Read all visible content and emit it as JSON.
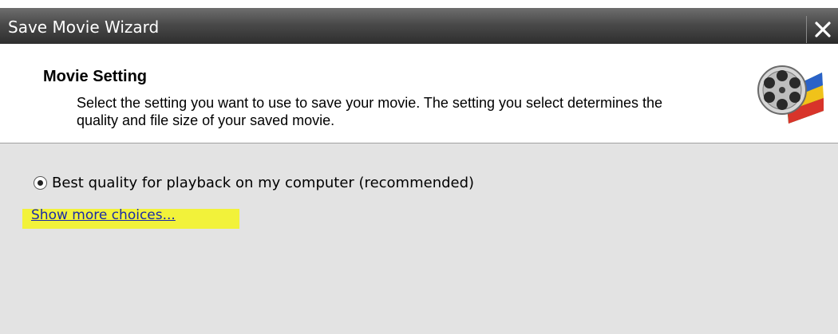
{
  "window": {
    "title": "Save Movie Wizard",
    "close_icon": "close-icon"
  },
  "header": {
    "title": "Movie Setting",
    "description": "Select the setting you want to use to save your movie. The setting you select determines the quality and file size of your saved movie.",
    "logo_icon": "movie-maker-film-reel-icon"
  },
  "options": {
    "selected_label": "Best quality for playback on my computer (recommended)",
    "selected": true,
    "more_choices_link": "Show more choices..."
  },
  "colors": {
    "highlight": "#f2f23a",
    "link": "#1a2aa8",
    "content_bg": "#e3e3e3"
  }
}
